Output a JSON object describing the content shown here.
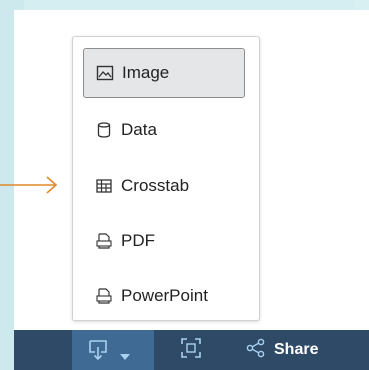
{
  "menu": {
    "items": [
      {
        "label": "Image",
        "icon": "image-icon",
        "selected": true
      },
      {
        "label": "Data",
        "icon": "database-icon",
        "selected": false
      },
      {
        "label": "Crosstab",
        "icon": "table-icon",
        "selected": false
      },
      {
        "label": "PDF",
        "icon": "pdf-icon",
        "selected": false
      },
      {
        "label": "PowerPoint",
        "icon": "powerpoint-icon",
        "selected": false
      }
    ]
  },
  "toolbar": {
    "download": {
      "icon": "download-icon",
      "caret": "caret-down-icon"
    },
    "fullscreen": {
      "icon": "fullscreen-icon"
    },
    "share": {
      "icon": "share-icon",
      "label": "Share"
    }
  },
  "colors": {
    "toolbar_bg": "#2e4a66",
    "toolbar_selected": "#3f6a93",
    "arrow": "#e08a2c",
    "icon_light": "#a9d1f2"
  }
}
